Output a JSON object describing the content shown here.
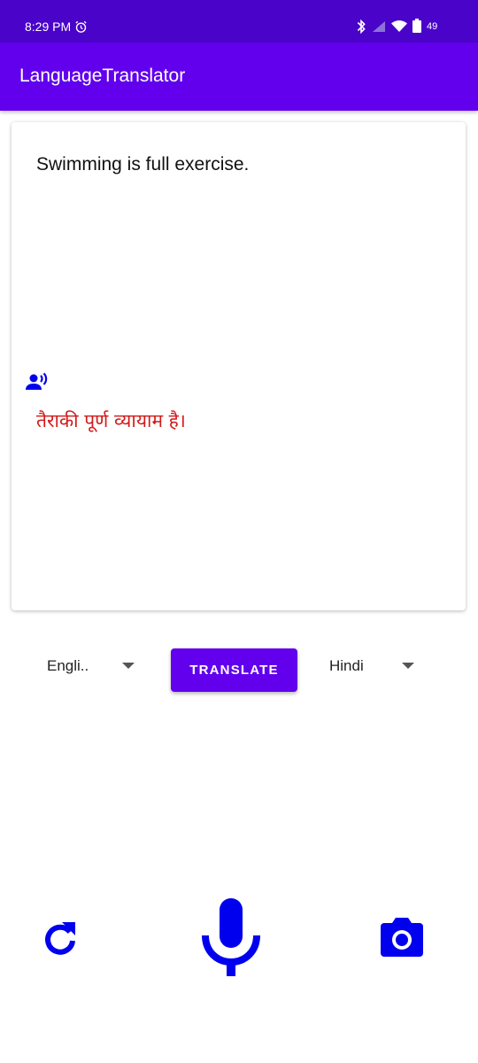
{
  "status_bar": {
    "time": "8:29 PM",
    "battery": "49",
    "icons": [
      "alarm-icon",
      "bluetooth-icon",
      "signal-icon",
      "wifi-icon",
      "battery-icon"
    ]
  },
  "app_bar": {
    "title": "LanguageTranslator"
  },
  "translation_card": {
    "source_text": "Swimming is full exercise.",
    "translated_text": "तैराकी पूर्ण व्यायाम है।",
    "speak_icon": "record-voice-icon"
  },
  "controls": {
    "source_language": "Engli..",
    "target_language": "Hindi",
    "translate_label": "TRANSLATE"
  },
  "bottom_actions": {
    "icons": [
      "refresh-icon",
      "microphone-icon",
      "camera-icon"
    ]
  },
  "colors": {
    "status_bar": "#4a04c9",
    "primary": "#6200ee",
    "accent_icon": "#0000ee",
    "translated_text": "#d11a1a"
  }
}
